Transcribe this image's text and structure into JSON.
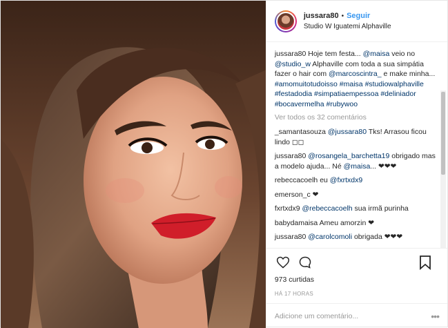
{
  "header": {
    "username": "jussara80",
    "separator": "•",
    "follow_label": "Seguir",
    "location": "Studio W Iguatemi Alphaville"
  },
  "caption": {
    "user": "jussara80",
    "t1": " Hoje tem festa... ",
    "m1": "@maisa",
    "t2": " veio no ",
    "m2": "@studio_w",
    "t3": " Alphaville com toda a sua simpátia fazer o hair com ",
    "m3": "@marcoscintra_",
    "t4": " e make minha... ",
    "h1": "#amomuitotudoisso",
    "h2": "#maisa",
    "h3": "#studiowalphaville",
    "h4": "#festadodia",
    "h5": "#simpatiaempessoa",
    "h6": "#deliniador",
    "h7": "#bocavermelha",
    "h8": "#rubywoo"
  },
  "view_all": "Ver todos os 32 comentários",
  "comments": [
    {
      "user": "_samantasouza",
      "mention": "@jussara80",
      "text": " Tks! Arrasou ficou lindo ◻◻"
    },
    {
      "user": "jussara80",
      "mention": "@rosangela_barchetta19",
      "text": " obrigado mas a modelo ajuda... Né ",
      "mention2": "@maisa",
      "text2": "... ❤❤❤"
    },
    {
      "user": "rebeccacoelh",
      "text": " eu ",
      "mention": "@fxrtxdx9"
    },
    {
      "user": "emerson_c",
      "text": " ❤"
    },
    {
      "user": "fxrtxdx9",
      "mention": "@rebeccacoelh",
      "text": " sua irmã purinha"
    },
    {
      "user": "babydamaisa",
      "text": " Ameu amorzin ❤"
    },
    {
      "user": "jussara80",
      "mention": "@carolcomoli",
      "text": " obrigada ❤❤❤"
    }
  ],
  "likes": "973 curtidas",
  "time": "HÁ 17 HORAS",
  "add_comment": {
    "placeholder": "Adicione um comentário...",
    "more": "•••"
  },
  "colors": {
    "link": "#003569",
    "follow": "#3897f0",
    "muted": "#999999"
  },
  "icons": [
    "heart-icon",
    "comment-icon",
    "bookmark-icon"
  ]
}
